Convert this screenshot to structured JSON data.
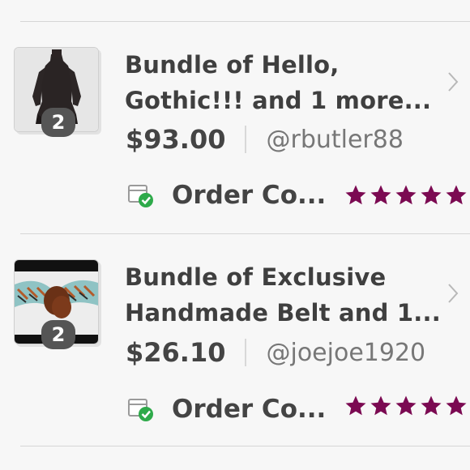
{
  "colors": {
    "star": "#7b0a52",
    "badge": "#555555",
    "check": "#2eaa4a",
    "divider": "#d6d6d6"
  },
  "orders": [
    {
      "thumbnail_icon": "black-coat-photo",
      "item_count": "2",
      "title_line1": "Bundle of Hello,",
      "title_line2": "Gothic!!! and 1 more...",
      "price": "$93.00",
      "seller": "@rbutler88",
      "status": "Order Co...",
      "status_icon": "package-check-icon",
      "rating": 5
    },
    {
      "thumbnail_icon": "beaded-belt-photo",
      "item_count": "2",
      "title_line1": "Bundle of Exclusive",
      "title_line2": "Handmade Belt and 1...",
      "price": "$26.10",
      "seller": "@joejoe1920",
      "status": "Order Co...",
      "status_icon": "package-check-icon",
      "rating": 5
    }
  ]
}
